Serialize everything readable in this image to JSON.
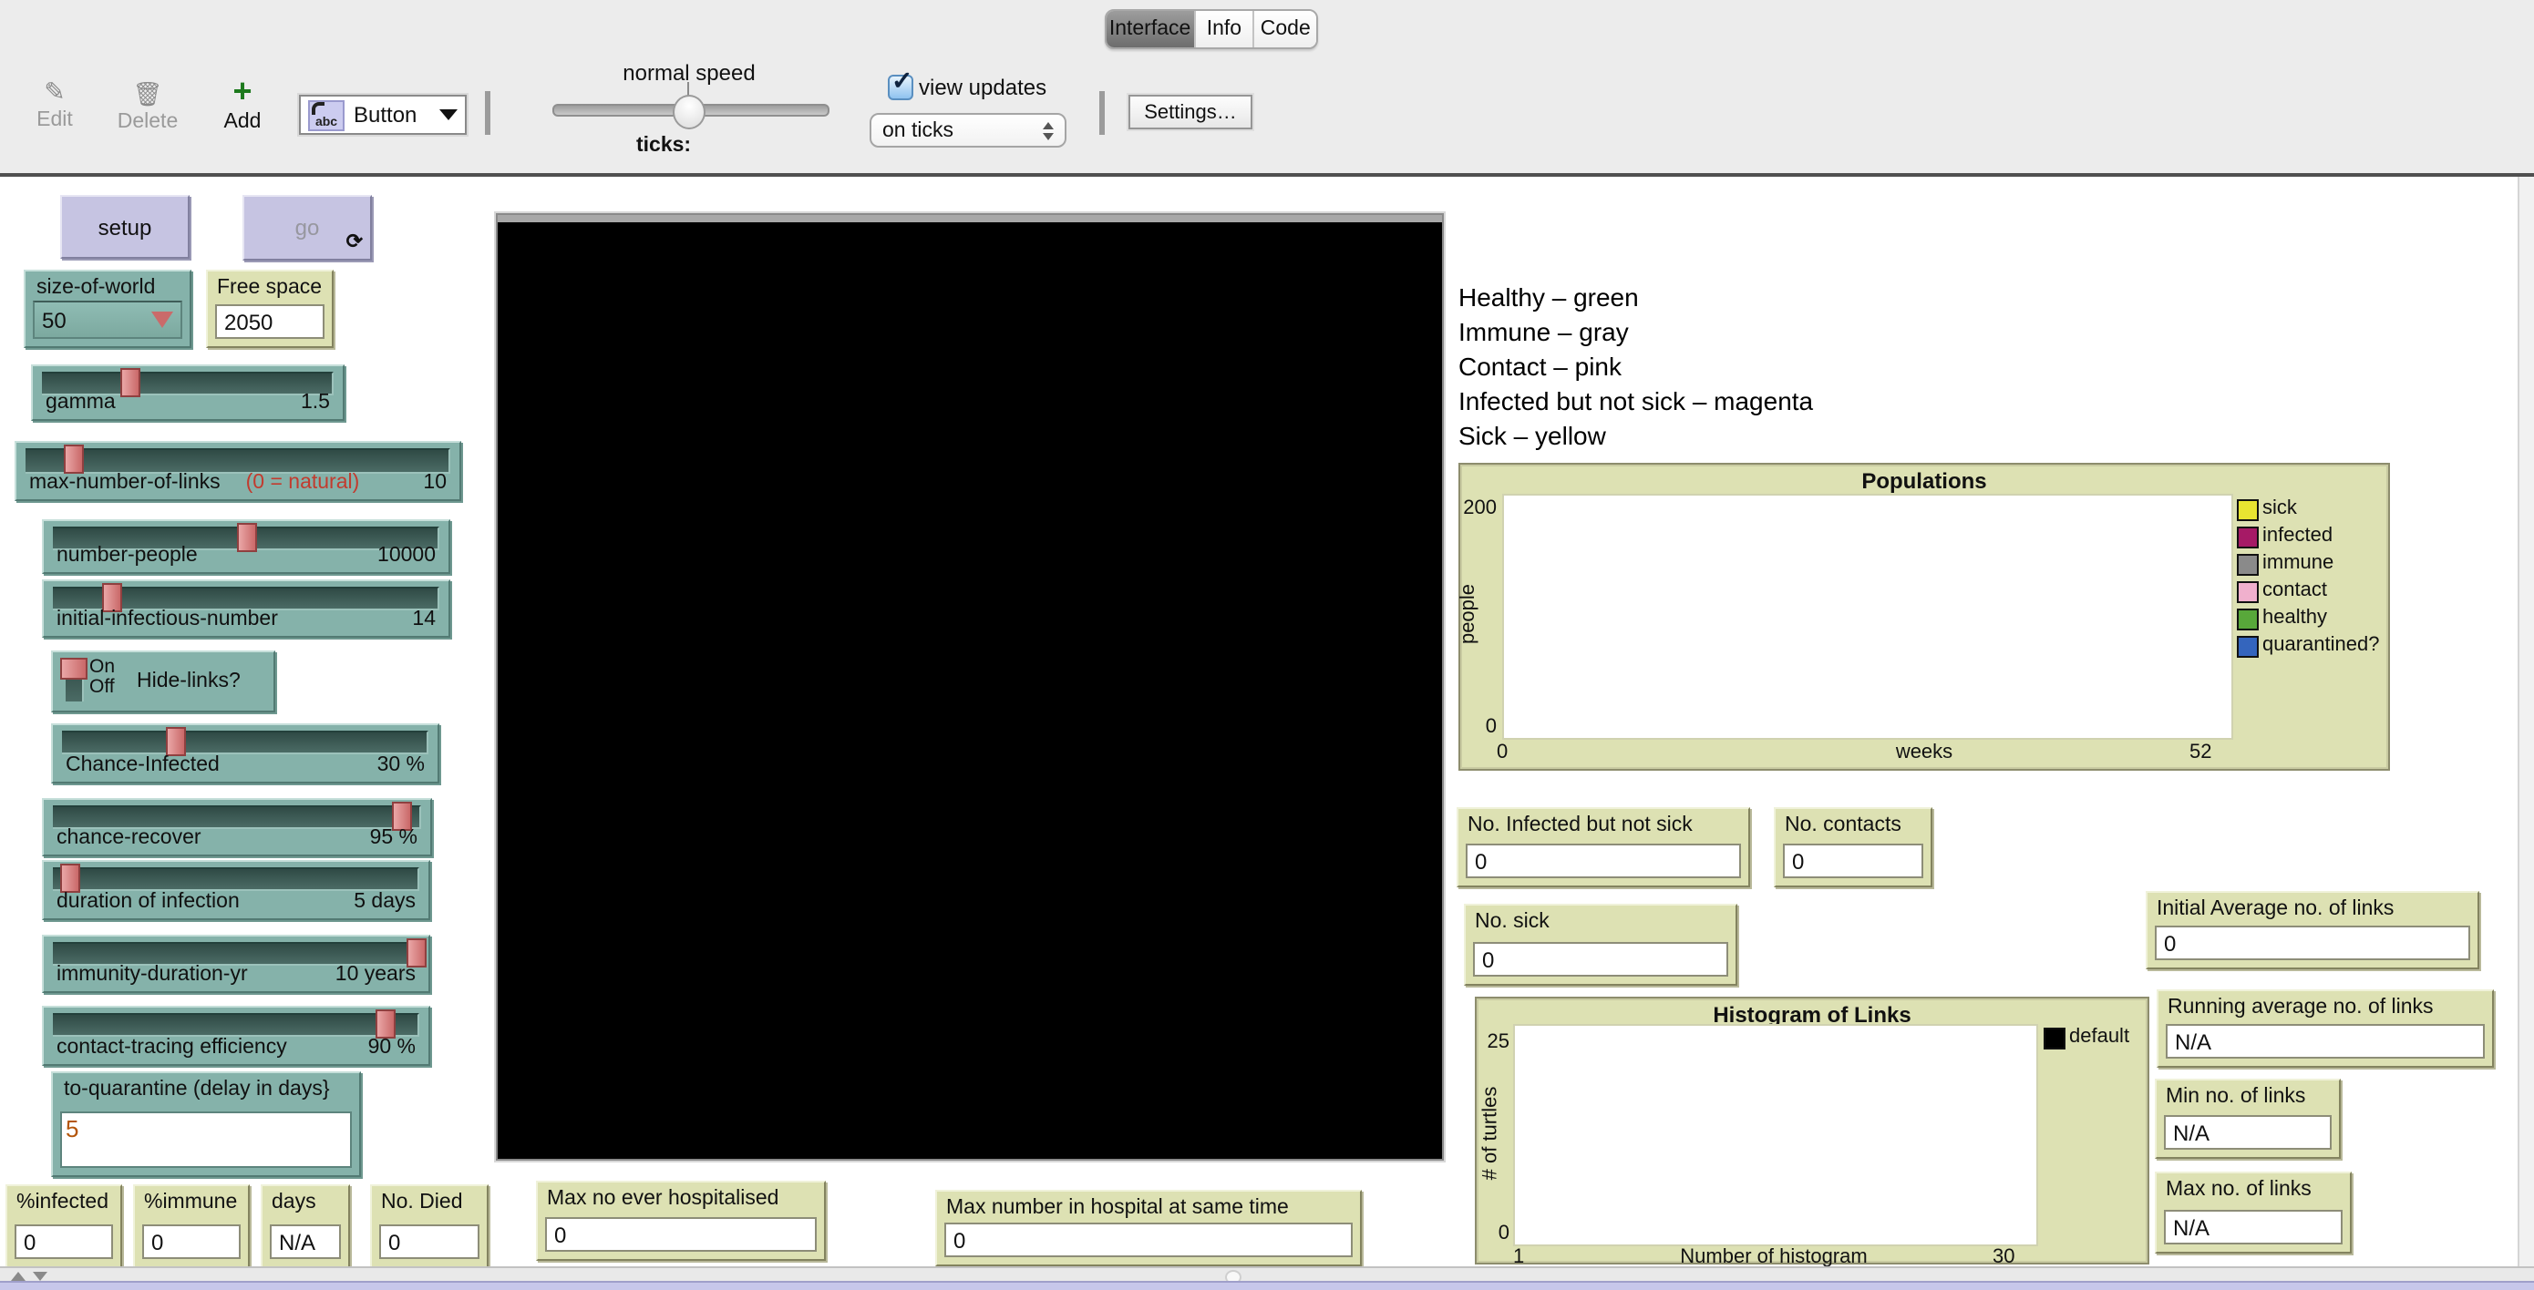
{
  "toolbar": {
    "tabs": [
      "Interface",
      "Info",
      "Code"
    ],
    "active_tab": "Interface",
    "edit_label": "Edit",
    "delete_label": "Delete",
    "add_label": "Add",
    "widget_selector": "Button",
    "widget_selector_icon": "abc",
    "speed_label": "normal speed",
    "ticks_label": "ticks:",
    "view_updates_label": "view updates",
    "update_mode": "on ticks",
    "settings_label": "Settings…"
  },
  "buttons": {
    "setup": "setup",
    "go": "go",
    "go_forever_icon": "⟳"
  },
  "chooser": {
    "label": "size-of-world",
    "value": "50"
  },
  "sliders": [
    {
      "label": "gamma",
      "value": "1.5"
    },
    {
      "label": "max-number-of-links",
      "note": "(0 = natural)",
      "value": "10"
    },
    {
      "label": "number-people",
      "value": "10000"
    },
    {
      "label": "initial-infectious-number",
      "value": "14"
    },
    {
      "label": "Chance-Infected",
      "value": "30 %"
    },
    {
      "label": "chance-recover",
      "value": "95 %"
    },
    {
      "label": "duration of infection",
      "value": "5 days"
    },
    {
      "label": "immunity-duration-yr",
      "value": "10 years"
    },
    {
      "label": "contact-tracing  efficiency",
      "value": "90 %"
    }
  ],
  "switch": {
    "on": "On",
    "off": "Off",
    "label": "Hide-links?"
  },
  "input": {
    "label": "to-quarantine  (delay in days}",
    "value": "5"
  },
  "monitors": {
    "free_space": {
      "label": "Free space",
      "value": "2050"
    },
    "pct_infected": {
      "label": "%infected",
      "value": "0"
    },
    "pct_immune": {
      "label": "%immune",
      "value": "0"
    },
    "days": {
      "label": "days",
      "value": "N/A"
    },
    "no_died": {
      "label": "No. Died",
      "value": "0"
    },
    "max_ever_hospitalised": {
      "label": "Max no ever hospitalised",
      "value": "0"
    },
    "max_in_hospital": {
      "label": "Max number in hospital at same time",
      "value": "0"
    },
    "infected_not_sick": {
      "label": "No. Infected but not sick",
      "value": "0"
    },
    "contacts": {
      "label": "No. contacts",
      "value": "0"
    },
    "sick": {
      "label": "No. sick",
      "value": "0"
    },
    "initial_avg_links": {
      "label": "Initial Average no. of links",
      "value": "0"
    },
    "running_avg_links": {
      "label": "Running average no. of links",
      "value": "N/A"
    },
    "min_links": {
      "label": "Min no. of links",
      "value": "N/A"
    },
    "max_links": {
      "label": "Max no. of links",
      "value": "N/A"
    }
  },
  "note_lines": [
    "Healthy – green",
    "Immune – gray",
    "Contact – pink",
    "Infected but not sick – magenta",
    "Sick – yellow"
  ],
  "plots": {
    "populations": {
      "title": "Populations",
      "ylabel": "people",
      "xlabel": "weeks",
      "ymax": "200",
      "ymin": "0",
      "xmin": "0",
      "xmax": "52",
      "legend": [
        {
          "label": "sick",
          "color": "#e8e431"
        },
        {
          "label": "infected",
          "color": "#a61a66"
        },
        {
          "label": "immune",
          "color": "#8a8a8a"
        },
        {
          "label": "contact",
          "color": "#f0b0cd"
        },
        {
          "label": "healthy",
          "color": "#58a83a"
        },
        {
          "label": "quarantined?",
          "color": "#3465bd"
        }
      ],
      "series_data": []
    },
    "histogram": {
      "title": "Histogram of Links",
      "ylabel": "# of turtles",
      "xlabel": "Number of histogram",
      "ymax": "25",
      "ymin": "0",
      "xmin": "1",
      "xmax": "30",
      "legend": [
        {
          "label": "default",
          "color": "#000000"
        }
      ],
      "series_data": []
    }
  }
}
